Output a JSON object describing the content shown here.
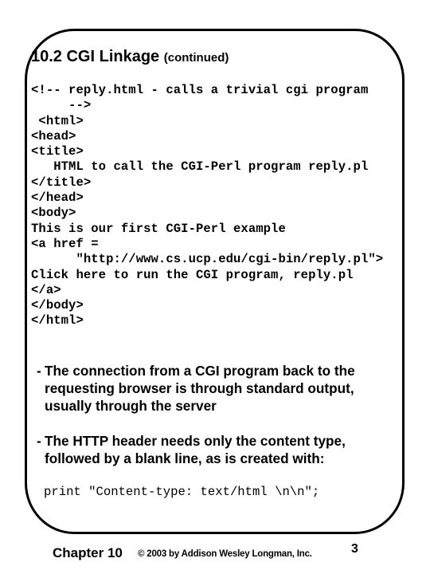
{
  "slide": {
    "title": "10.2 CGI Linkage",
    "title_suffix": "(continued)",
    "code_lines": [
      "<!-- reply.html - calls a trivial cgi program",
      "     -->",
      " <html>",
      "<head>",
      "<title>",
      "   HTML to call the CGI-Perl program reply.pl",
      "</title>",
      "</head>",
      "<body>",
      "This is our first CGI-Perl example",
      "<a href =",
      "      \"http://www.cs.ucp.edu/cgi-bin/reply.pl\">",
      "Click here to run the CGI program, reply.pl",
      "</a>",
      "</body>",
      "</html>"
    ],
    "bullets": [
      {
        "dash": "-",
        "lines": [
          "The connection from a CGI program back to the",
          "requesting browser is through standard output,",
          "usually through the server"
        ]
      },
      {
        "dash": "-",
        "lines": [
          "The HTTP header needs only the content type,",
          "followed by a blank line, as is created with:"
        ]
      }
    ],
    "print_statement": "print \"Content-type: text/html \\n\\n\";"
  },
  "footer": {
    "chapter": "Chapter 10",
    "copyright": "© 2003 by Addison Wesley Longman, Inc.",
    "page_number": "3"
  }
}
